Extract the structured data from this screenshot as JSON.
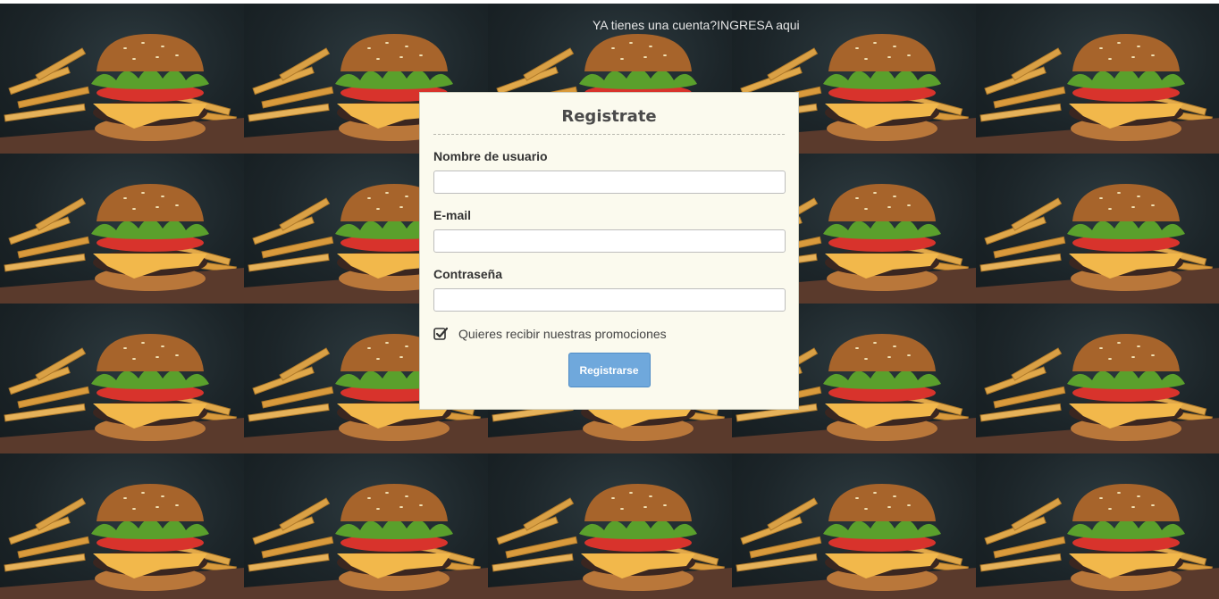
{
  "header": {
    "login_link": "YA tienes una cuenta?INGRESA aqui"
  },
  "form": {
    "title": "Registrate",
    "username_label": "Nombre de usuario",
    "username_value": "",
    "email_label": "E-mail",
    "email_value": "",
    "password_label": "Contraseña",
    "password_value": "",
    "promo_label": "Quieres recibir nuestras promociones",
    "promo_checked": true,
    "submit_label": "Registrarse"
  },
  "background": {
    "image": "burger-with-fries-photo",
    "tiles_columns": 5,
    "tiles_rows": 4
  },
  "colors": {
    "card_bg": "#fbfaee",
    "button_bg": "#6fa8dc",
    "link_text": "#e6e6e6"
  }
}
